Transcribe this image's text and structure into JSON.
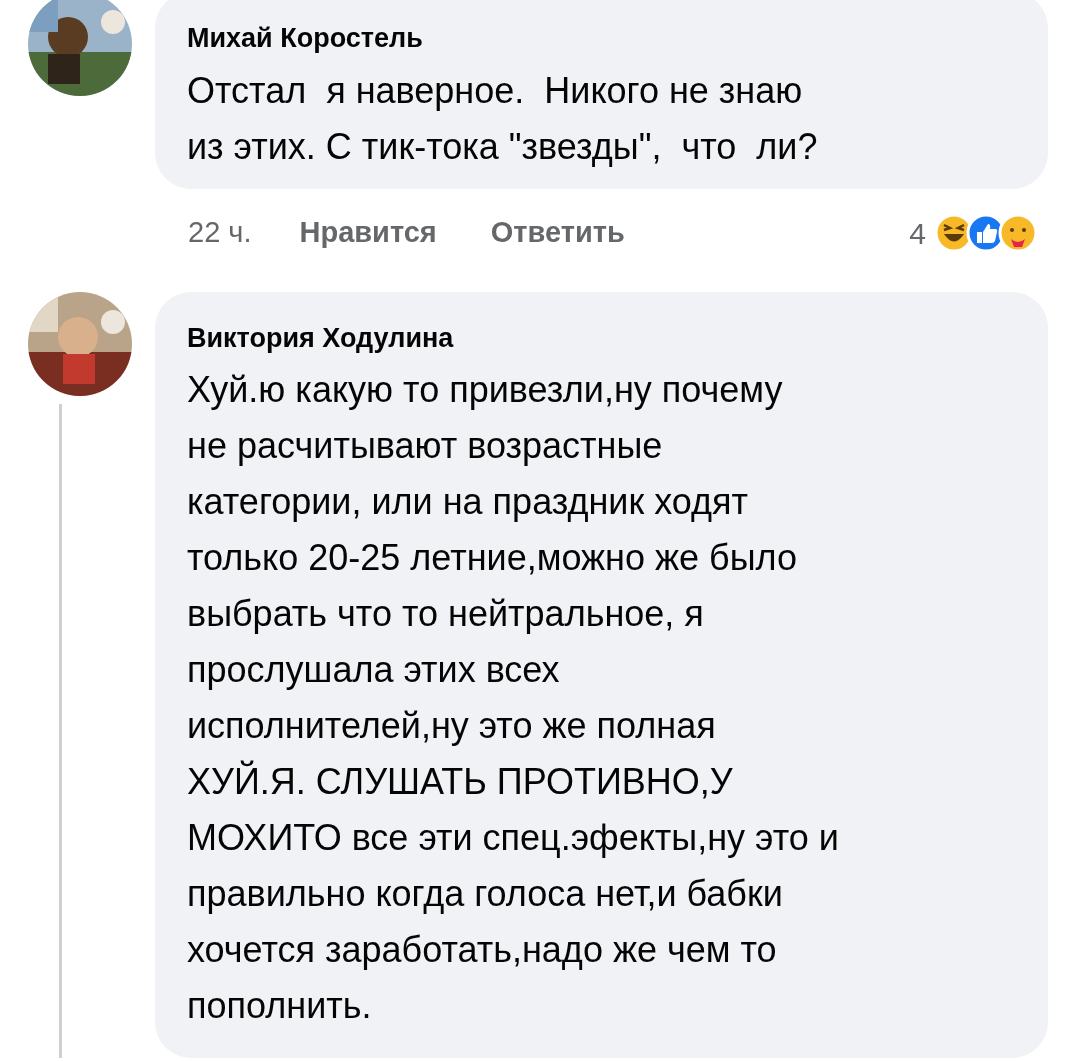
{
  "comments": [
    {
      "author": "Михай Коростель",
      "lines": [
        "Отстал  я наверное.  Никого не знаю",
        "из этих. С тик-тока \"звезды\",  что  ли?"
      ],
      "time": "22 ч.",
      "like": "Нравится",
      "reply": "Ответить",
      "reaction_count": "4",
      "thread_line": false
    },
    {
      "author": "Виктория Ходулина",
      "lines": [
        "Хуй.ю какую то привезли,ну почему",
        "не расчитывают возрастные",
        "категории, или на праздник ходят",
        "только 20-25 летние,можно же было",
        "выбрать что то нейтральное, я",
        "прослушала этих всех",
        "исполнителей,ну это же полная",
        "ХУЙ.Я. СЛУШАТЬ ПРОТИВНО,У",
        "МОХИТО все эти спец.эфекты,ну это и",
        "правильно когда голоса нет,и бабки",
        "хочется заработать,надо же чем то",
        "пополнить."
      ],
      "thread_line": true
    }
  ]
}
